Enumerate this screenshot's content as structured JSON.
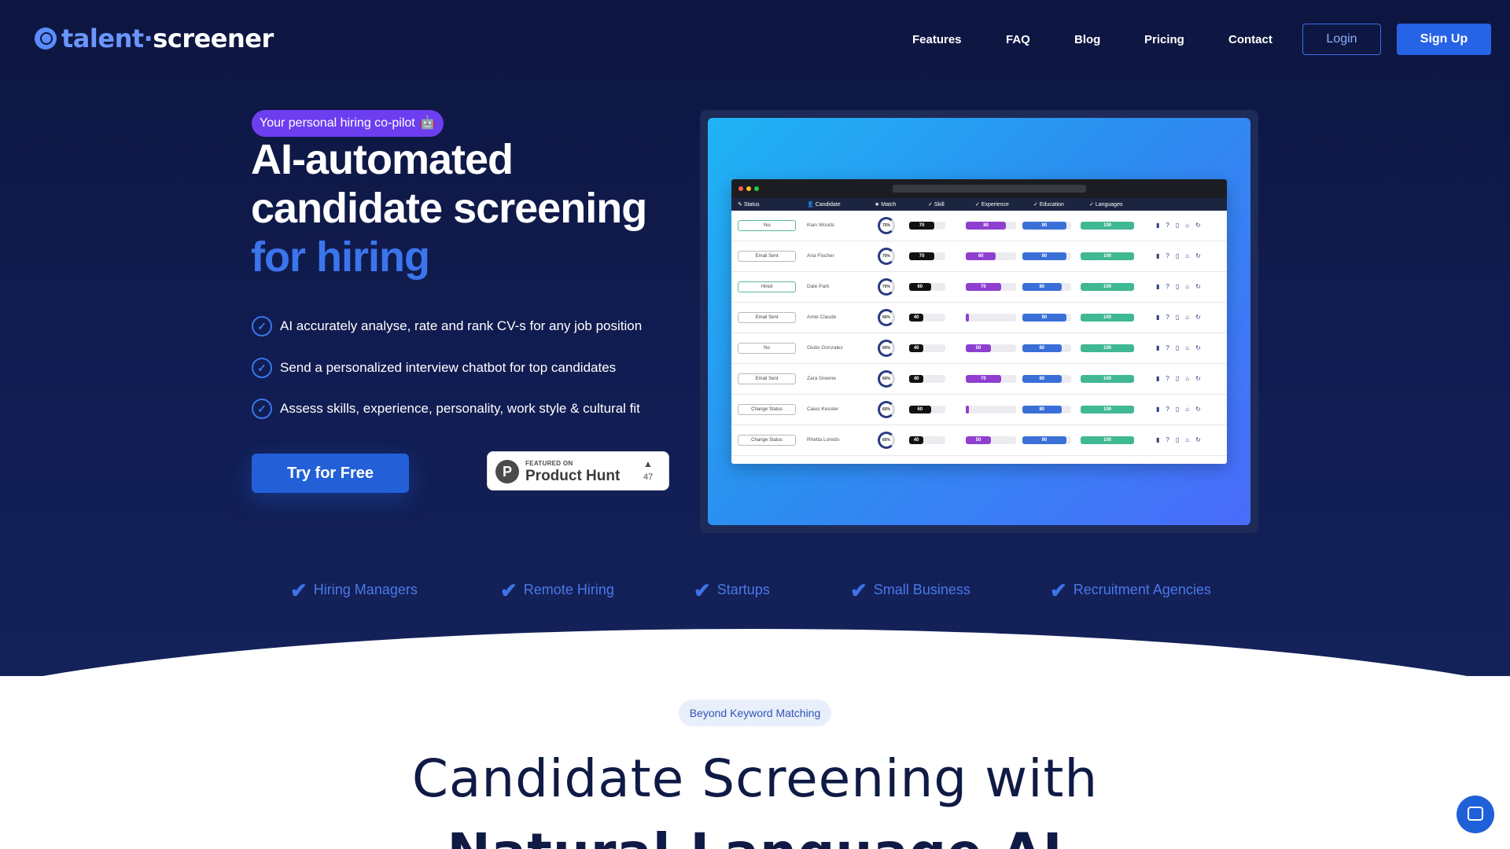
{
  "brand": {
    "part1": "talent",
    "sep": "·",
    "part2": "screener"
  },
  "nav": {
    "links": [
      "Features",
      "FAQ",
      "Blog",
      "Pricing",
      "Contact"
    ],
    "login_label": "Login",
    "signup_label": "Sign Up"
  },
  "hero": {
    "pill": "Your personal hiring co-pilot",
    "pill_emoji": "🤖",
    "title_line1": "AI-automated",
    "title_line2": "candidate screening",
    "title_line3": "for hiring",
    "bullets": [
      "AI accurately analyse, rate and rank CV-s for any job position",
      "Send a personalized interview chatbot for top candidates",
      "Assess skills, experience, personality, work style &  cultural fit"
    ],
    "cta_label": "Try for Free",
    "product_hunt": {
      "small": "FEATURED ON",
      "big": "Product Hunt",
      "count": "47"
    }
  },
  "preview": {
    "columns": [
      "Status",
      "Candidate",
      "Match",
      "Skill",
      "Experience",
      "Education",
      "Languages"
    ],
    "rows": [
      {
        "status": "Yes",
        "name": "Kian Woods",
        "match": "75%",
        "skill": 70,
        "experience": 80,
        "education": 90,
        "languages": 100
      },
      {
        "status": "Email Sent",
        "name": "Aria Fischer",
        "match": "70%",
        "skill": 70,
        "experience": 60,
        "education": 90,
        "languages": 100
      },
      {
        "status": "Hired",
        "name": "Dale Park",
        "match": "70%",
        "skill": 60,
        "experience": 70,
        "education": 80,
        "languages": 100
      },
      {
        "status": "Email Sent",
        "name": "Amie Claude",
        "match": "60%",
        "skill": 40,
        "experience": 0,
        "education": 90,
        "languages": 100
      },
      {
        "status": "No",
        "name": "Giulio Gonzalez",
        "match": "60%",
        "skill": 40,
        "experience": 50,
        "education": 80,
        "languages": 100
      },
      {
        "status": "Email Sent",
        "name": "Zara Greene",
        "match": "60%",
        "skill": 40,
        "experience": 70,
        "education": 80,
        "languages": 100
      },
      {
        "status": "Change Status",
        "name": "Caius Kessler",
        "match": "60%",
        "skill": 60,
        "experience": 0,
        "education": 80,
        "languages": 100
      },
      {
        "status": "Change Status",
        "name": "Rhetta Loredo",
        "match": "60%",
        "skill": 40,
        "experience": 50,
        "education": 90,
        "languages": 100
      }
    ]
  },
  "audiences": [
    "Hiring Managers",
    "Remote Hiring",
    "Startups",
    "Small Business",
    "Recruitment Agencies"
  ],
  "section2": {
    "tag": "Beyond Keyword Matching",
    "title_line1": "Candidate Screening with",
    "title_line2": "Natural Language AI"
  },
  "colors": {
    "hero_bg": "#0d1640",
    "accent": "#3b75ec",
    "purple": "#6d3df0",
    "teal": "#3fb893",
    "violet": "#8e3fd0",
    "blue_bar": "#3a6fd8"
  }
}
